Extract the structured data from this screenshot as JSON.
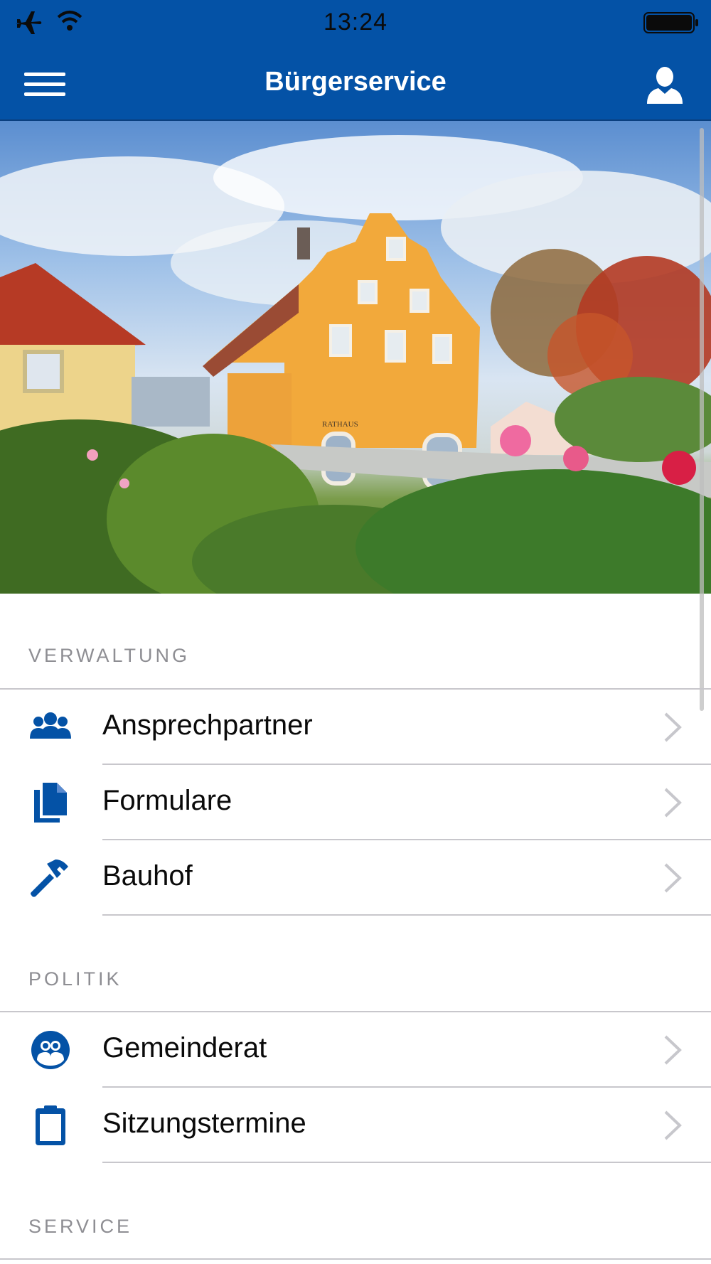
{
  "status_bar": {
    "time": "13:24",
    "icons": [
      "airplane-icon",
      "wifi-icon",
      "battery-icon"
    ]
  },
  "nav": {
    "title": "Bürgerservice",
    "left_icon": "hamburger-menu-icon",
    "right_icon": "user-profile-icon",
    "background_color": "#0452a6"
  },
  "hero": {
    "sign_text": "RATHAUS"
  },
  "sections": [
    {
      "header": "VERWALTUNG",
      "items": [
        {
          "label": "Ansprechpartner",
          "icon": "people-group-icon"
        },
        {
          "label": "Formulare",
          "icon": "documents-icon"
        },
        {
          "label": "Bauhof",
          "icon": "hammer-icon"
        }
      ]
    },
    {
      "header": "POLITIK",
      "items": [
        {
          "label": "Gemeinderat",
          "icon": "council-people-circle-icon"
        },
        {
          "label": "Sitzungstermine",
          "icon": "clipboard-icon"
        }
      ]
    },
    {
      "header": "SERVICE",
      "items": []
    }
  ],
  "colors": {
    "accent": "#0452a6",
    "section_header": "#8e8e93",
    "chevron": "#c7c7cc",
    "divider": "#c8c7cc"
  }
}
